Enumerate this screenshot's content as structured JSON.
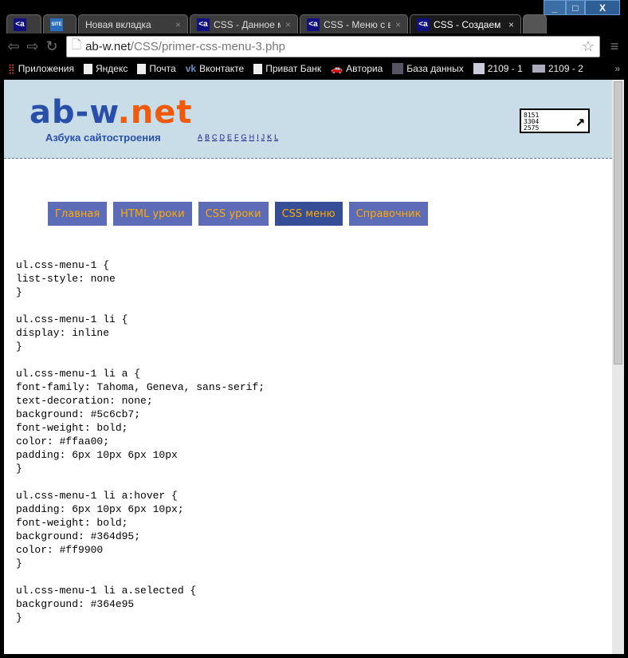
{
  "window_controls": [
    "_",
    "□",
    "X"
  ],
  "tabs": [
    {
      "icon": "<a",
      "label": ""
    },
    {
      "icon": "SITE",
      "label": ""
    },
    {
      "icon": "",
      "label": "Новая вкладка"
    },
    {
      "icon": "<a",
      "label": "CSS - Данное ме"
    },
    {
      "icon": "<a",
      "label": "CSS - Меню с вы"
    },
    {
      "icon": "<a",
      "label": "CSS - Создаем с"
    }
  ],
  "url": {
    "host": "ab-w.net",
    "path": "/CSS/primer-css-menu-3.php"
  },
  "bookmarks": [
    "Приложения",
    "Яндекс",
    "Почта",
    "Вконтакте",
    "Приват Банк",
    "Авториа",
    "База данных",
    "2109 - 1",
    "2109 - 2"
  ],
  "bookmarks_more": "»",
  "site": {
    "logo_main": "ab-w",
    "logo_dot": ".",
    "logo_net": "net",
    "tagline": "Азбука сайтостроения",
    "alphabet": [
      "A",
      "B",
      "C",
      "D",
      "E",
      "F",
      "G",
      "H",
      "I",
      "J",
      "K",
      "L"
    ],
    "counter": [
      "8151",
      "3304",
      "2575"
    ]
  },
  "menu": [
    {
      "label": "Главная"
    },
    {
      "label": "HTML уроки"
    },
    {
      "label": "CSS уроки"
    },
    {
      "label": "CSS меню",
      "selected": true
    },
    {
      "label": "Справочник"
    }
  ],
  "code": "ul.css-menu-1 {\nlist-style: none\n}\n\nul.css-menu-1 li {\ndisplay: inline\n}\n\nul.css-menu-1 li a {\nfont-family: Tahoma, Geneva, sans-serif;\ntext-decoration: none;\nbackground: #5c6cb7;\nfont-weight: bold;\ncolor: #ffaa00;\npadding: 6px 10px 6px 10px\n}\n\nul.css-menu-1 li a:hover {\npadding: 6px 10px 6px 10px;\nfont-weight: bold;\nbackground: #364d95;\ncolor: #ff9900\n}\n\nul.css-menu-1 li a.selected {\nbackground: #364e95\n}"
}
